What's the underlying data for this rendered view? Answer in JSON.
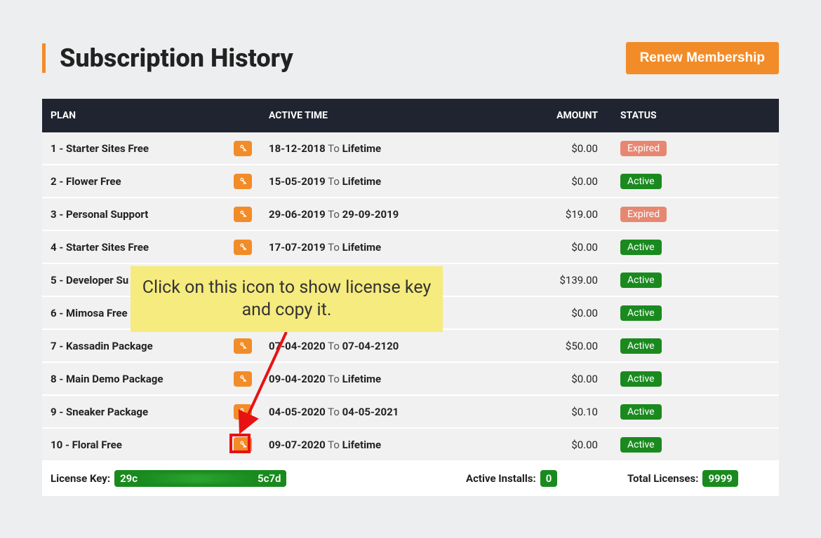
{
  "header": {
    "title": "Subscription History",
    "renew_btn": "Renew Membership"
  },
  "columns": {
    "plan": "PLAN",
    "active_time": "ACTIVE TIME",
    "amount": "AMOUNT",
    "status": "STATUS"
  },
  "rows": [
    {
      "plan": "1 - Starter Sites Free",
      "d1": "18-12-2018",
      "to": "To",
      "d2": "Lifetime",
      "amount": "$0.00",
      "status": "Expired",
      "status_class": "expired"
    },
    {
      "plan": "2 - Flower Free",
      "d1": "15-05-2019",
      "to": "To",
      "d2": "Lifetime",
      "amount": "$0.00",
      "status": "Active",
      "status_class": "active"
    },
    {
      "plan": "3 - Personal Support",
      "d1": "29-06-2019",
      "to": "To",
      "d2": "29-09-2019",
      "amount": "$19.00",
      "status": "Expired",
      "status_class": "expired"
    },
    {
      "plan": "4 - Starter Sites Free",
      "d1": "17-07-2019",
      "to": "To",
      "d2": "Lifetime",
      "amount": "$0.00",
      "status": "Active",
      "status_class": "active"
    },
    {
      "plan": "5 - Developer Su",
      "d1": "",
      "to": "",
      "d2": "",
      "amount": "$139.00",
      "status": "Active",
      "status_class": "active"
    },
    {
      "plan": "6 - Mimosa Free",
      "d1": "",
      "to": "",
      "d2": "",
      "amount": "$0.00",
      "status": "Active",
      "status_class": "active"
    },
    {
      "plan": "7 - Kassadin Package",
      "d1": "07-04-2020",
      "to": "To",
      "d2": "07-04-2120",
      "amount": "$50.00",
      "status": "Active",
      "status_class": "active"
    },
    {
      "plan": "8 - Main Demo Package",
      "d1": "09-04-2020",
      "to": "To",
      "d2": "Lifetime",
      "amount": "$0.00",
      "status": "Active",
      "status_class": "active"
    },
    {
      "plan": "9 - Sneaker Package",
      "d1": "04-05-2020",
      "to": "To",
      "d2": "04-05-2021",
      "amount": "$0.10",
      "status": "Active",
      "status_class": "active"
    },
    {
      "plan": "10 - Floral Free",
      "d1": "09-07-2020",
      "to": "To",
      "d2": "Lifetime",
      "amount": "$0.00",
      "status": "Active",
      "status_class": "active"
    }
  ],
  "footer": {
    "license_key_label": "License Key:",
    "license_key_prefix": "29c",
    "license_key_suffix": "5c7d",
    "active_installs_label": "Active Installs:",
    "active_installs_value": "0",
    "total_licenses_label": "Total Licenses:",
    "total_licenses_value": "9999"
  },
  "annotation": {
    "text": "Click on this icon to show license key and copy it."
  }
}
